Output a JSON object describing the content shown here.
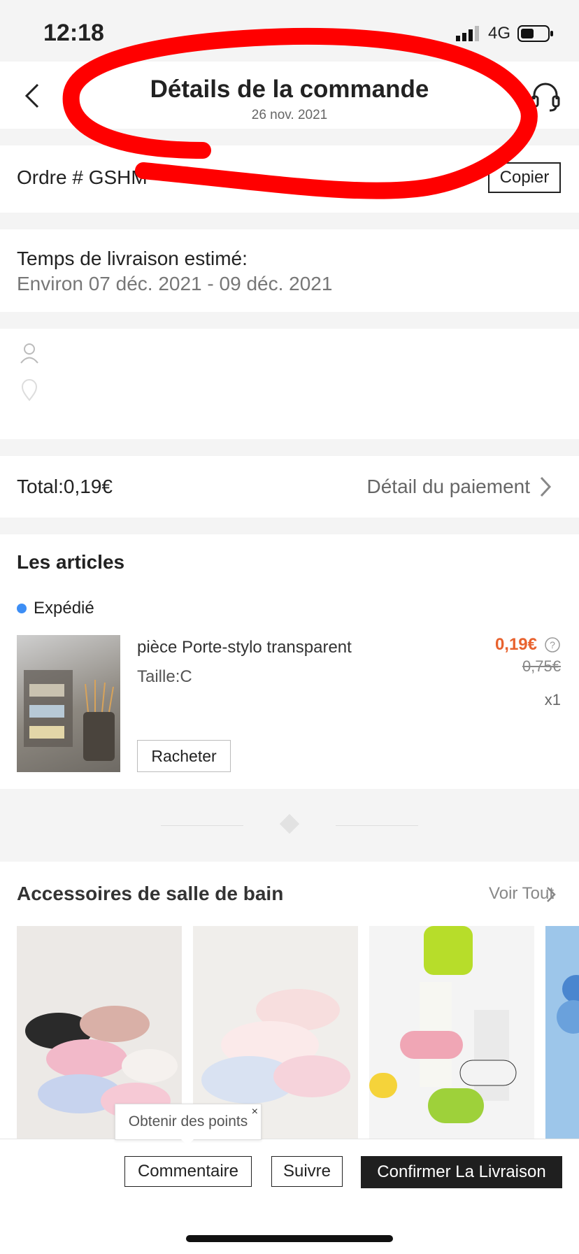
{
  "status_bar": {
    "time": "12:18",
    "network": "4G"
  },
  "header": {
    "title": "Détails de la commande",
    "date": "26 nov. 2021"
  },
  "order": {
    "label": "Ordre # GSHM",
    "copy_label": "Copier"
  },
  "delivery": {
    "label": "Temps de livraison estimé:",
    "dates": "Environ 07 déc. 2021 - 09 déc. 2021"
  },
  "payment": {
    "total": "Total:0,19€",
    "detail_label": "Détail du paiement"
  },
  "articles": {
    "title": "Les articles",
    "status": "Expédié",
    "product": {
      "name": "pièce Porte-stylo transparent",
      "size": "Taille:C",
      "price": "0,19€",
      "old_price": "0,75€",
      "qty": "x1",
      "rebuy_label": "Racheter"
    }
  },
  "recommendations": {
    "title": "Accessoires de salle de bain",
    "see_all": "Voir Tout"
  },
  "tooltip": {
    "text": "Obtenir des points",
    "close": "×"
  },
  "actions": {
    "comment": "Commentaire",
    "follow": "Suivre",
    "confirm": "Confirmer La Livraison"
  },
  "colors": {
    "price": "#e8622e",
    "status_dot": "#3d8ef5",
    "annotation": "#ff0000"
  }
}
